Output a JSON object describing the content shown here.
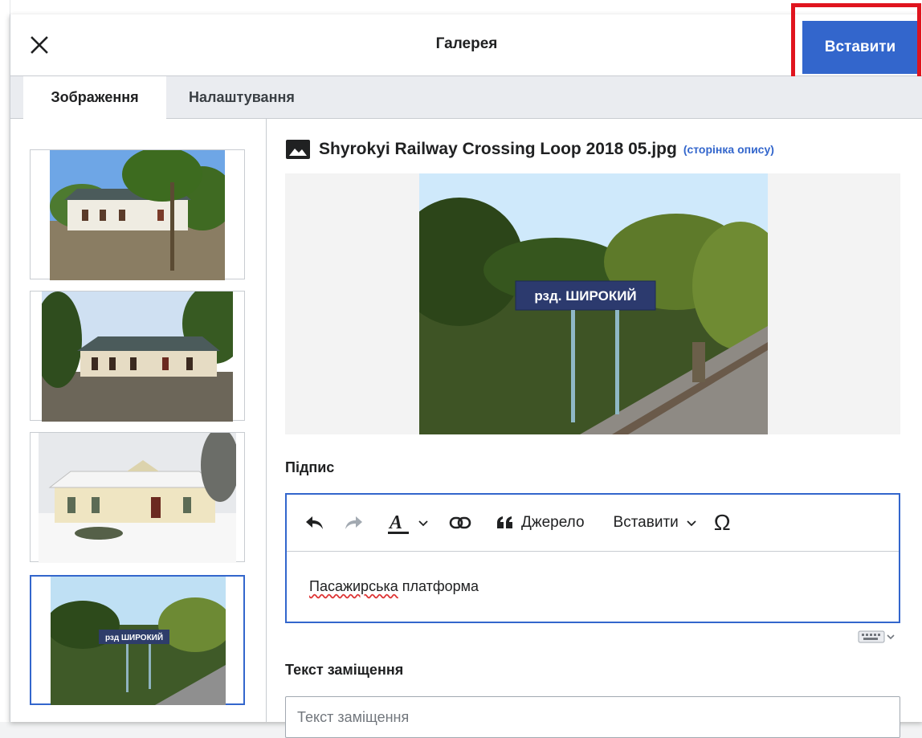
{
  "dialog": {
    "title": "Галерея",
    "insert_label": "Вставити"
  },
  "tabs": [
    {
      "label": "Зображення",
      "active": true
    },
    {
      "label": "Налаштування",
      "active": false
    }
  ],
  "gallery": {
    "thumbnails": [
      {
        "icon": "station-building-photo",
        "selected": false
      },
      {
        "icon": "station-building-photo",
        "selected": false
      },
      {
        "icon": "station-winter-photo",
        "selected": false
      },
      {
        "icon": "platform-sign-photo",
        "selected": true
      }
    ]
  },
  "details": {
    "filename": "Shyrokyi Railway Crossing Loop 2018 05.jpg",
    "desc_link": "(сторінка опису)",
    "preview_sign_text": "рзд. ШИРОКИЙ"
  },
  "caption": {
    "label": "Підпис",
    "toolbar": {
      "undo_icon": "undo-icon",
      "redo_icon": "redo-icon",
      "style_icon": "text-style-icon",
      "link_icon": "link-icon",
      "cite_label": "Джерело",
      "insert_label": "Вставити",
      "special_char": "Ω"
    },
    "text_underlined": "Пасажирська",
    "text_rest": " платформа"
  },
  "alt_text": {
    "label": "Текст заміщення",
    "placeholder": "Текст заміщення"
  },
  "colors": {
    "accent": "#3366cc",
    "highlight": "#e0141e"
  }
}
